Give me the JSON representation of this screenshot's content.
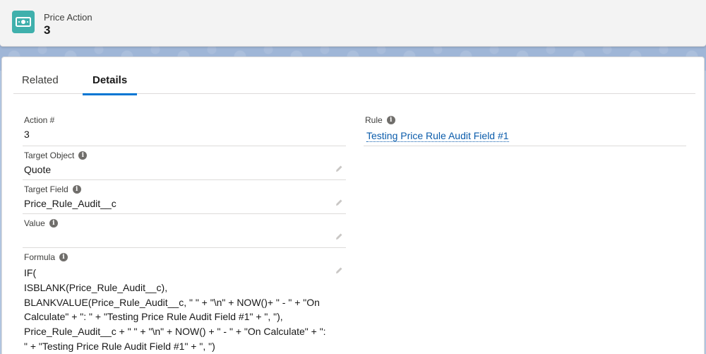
{
  "header": {
    "object_label": "Price Action",
    "record_name": "3"
  },
  "tabs": [
    {
      "label": "Related"
    },
    {
      "label": "Details"
    }
  ],
  "details": {
    "action_number": {
      "label": "Action #",
      "value": "3"
    },
    "target_object": {
      "label": "Target Object",
      "value": "Quote"
    },
    "target_field": {
      "label": "Target Field",
      "value": "Price_Rule_Audit__c"
    },
    "value": {
      "label": "Value",
      "value": ""
    },
    "formula": {
      "label": "Formula",
      "lines": [
        "IF(",
        "ISBLANK(Price_Rule_Audit__c),",
        "BLANKVALUE(Price_Rule_Audit__c, \" \" + \"\\n\" + NOW()+ \" - \" + \"On",
        "Calculate\" + \": \" + \"Testing Price Rule Audit Field #1\" + \", \"),",
        "Price_Rule_Audit__c + \" \" + \"\\n\" + NOW() + \" - \" + \"On Calculate\" + \":",
        "\" + \"Testing Price Rule Audit Field #1\" + \", \")"
      ]
    },
    "rule": {
      "label": "Rule",
      "value": "Testing Price Rule Audit Field #1"
    }
  },
  "colors": {
    "brand_icon": "#3fb0ac",
    "active_tab": "#0176d3",
    "link": "#0b5cab"
  }
}
